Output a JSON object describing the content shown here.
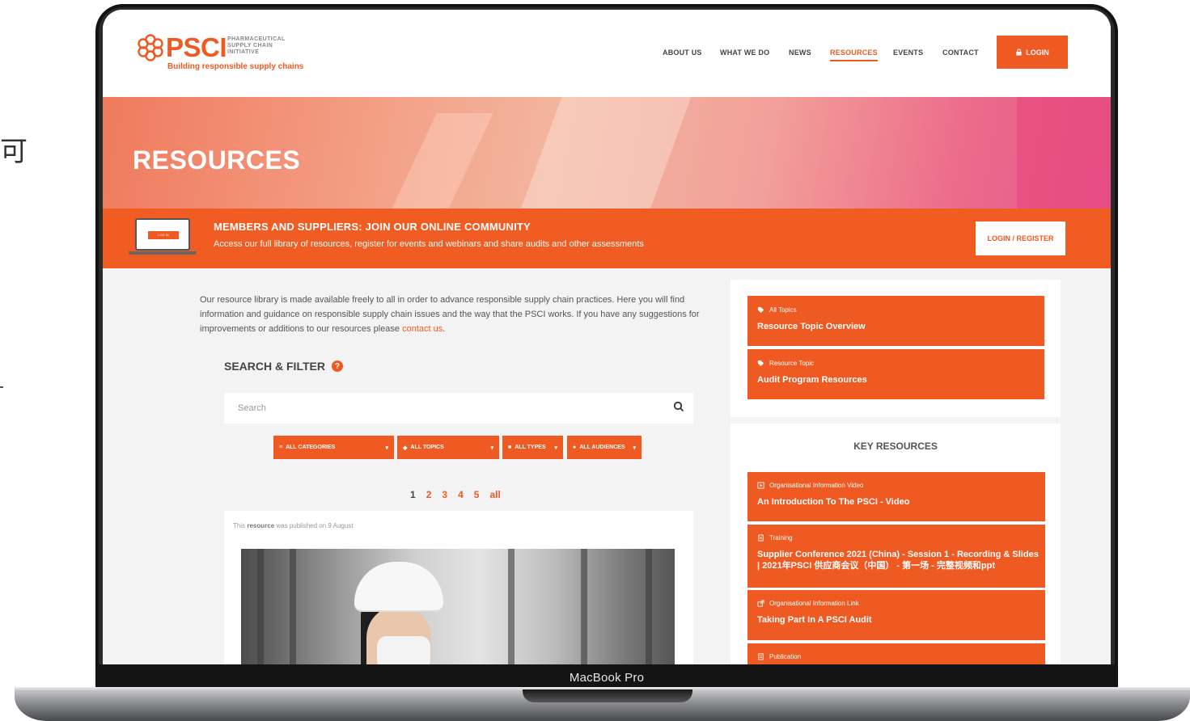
{
  "edge": {
    "glyph": "可"
  },
  "device": {
    "label": "MacBook Pro"
  },
  "header": {
    "logo_word": "PSCI",
    "logo_sub": "PHARMACEUTICAL SUPPLY CHAIN INITIATIVE",
    "logo_tagline": "Building responsible supply chains",
    "nav": [
      "ABOUT US",
      "WHAT WE DO",
      "NEWS",
      "RESOURCES",
      "EVENTS",
      "CONTACT"
    ],
    "login_label": "LOGIN"
  },
  "hero": {
    "title": "RESOURCES"
  },
  "banner": {
    "mini_button": "LOG IN",
    "title": "MEMBERS AND SUPPLIERS: JOIN OUR ONLINE COMMUNITY",
    "subtitle": "Access our full library of resources, register for events and webinars and share audits and other assessments",
    "button": "LOGIN / REGISTER"
  },
  "intro": {
    "text": "Our resource library is made available freely to all in order to advance responsible supply chain practices. Here you will find information and guidance on responsible supply chain issues and the way that the PSCI works. If you have any suggestions for improvements or additions to our resources please ",
    "link": "contact us",
    "end": "."
  },
  "search": {
    "heading": "SEARCH & FILTER",
    "help": "?",
    "placeholder": "Search",
    "filters": [
      "ALL CATEGORIES",
      "ALL TOPICS",
      "ALL TYPES",
      "ALL AUDIENCES"
    ]
  },
  "pagination": [
    "1",
    "2",
    "3",
    "4",
    "5",
    "all"
  ],
  "card": {
    "pub_prefix": "This ",
    "pub_bold": "resource",
    "pub_suffix": " was published on 9 August"
  },
  "topics": [
    {
      "small": "All Topics",
      "big": "Resource Topic Overview"
    },
    {
      "small": "Resource Topic",
      "big": "Audit Program Resources"
    }
  ],
  "key_resources": {
    "title": "KEY RESOURCES",
    "items": [
      {
        "small": "Organisational Information Video",
        "big": "An Introduction To The PSCI - Video",
        "icon": "video-icon"
      },
      {
        "small": "Training",
        "big": "Supplier Conference 2021 (China) - Session 1 - Recording & Slides | 2021年PSCI 供应商会议（中国） - 第一场 - 完整视频和ppt",
        "icon": "document-icon"
      },
      {
        "small": "Organisational Information Link",
        "big": "Taking Part In A PSCI Audit",
        "icon": "external-link-icon"
      },
      {
        "small": "Publication",
        "big": "",
        "icon": "document-icon"
      }
    ]
  },
  "colors": {
    "accent": "#ee5a22",
    "banner": "#f15c22"
  }
}
